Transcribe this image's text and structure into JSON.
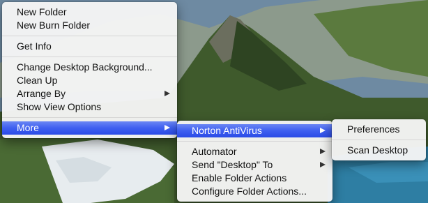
{
  "context_menu": {
    "items": [
      {
        "label": "New Folder"
      },
      {
        "label": "New Burn Folder"
      },
      {
        "label": "Get Info"
      },
      {
        "label": "Change Desktop Background..."
      },
      {
        "label": "Clean Up"
      },
      {
        "label": "Arrange By"
      },
      {
        "label": "Show View Options"
      },
      {
        "label": "More"
      }
    ]
  },
  "more_submenu": {
    "items": [
      {
        "label": "Norton AntiVirus"
      },
      {
        "label": "Automator"
      },
      {
        "label": "Send \"Desktop\" To"
      },
      {
        "label": "Enable Folder Actions"
      },
      {
        "label": "Configure Folder Actions..."
      }
    ]
  },
  "norton_submenu": {
    "items": [
      {
        "label": "Preferences"
      },
      {
        "label": "Scan Desktop"
      }
    ]
  },
  "colors": {
    "selection": "#3e5ff0",
    "menu_background": "#f5f5f5"
  },
  "icons": [
    "submenu-arrow-icon"
  ]
}
